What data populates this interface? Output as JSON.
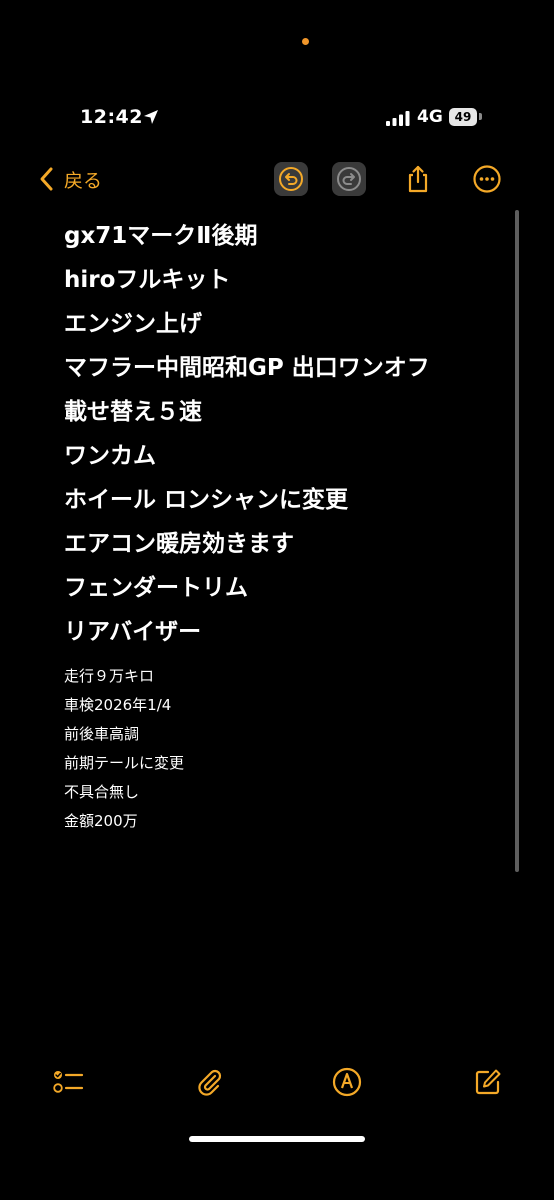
{
  "status_bar": {
    "time": "12:42",
    "network": "4G",
    "battery": "49"
  },
  "nav": {
    "back_label": "戻る"
  },
  "note": {
    "heading_lines": [
      "gx71マークⅡ後期",
      "hiroフルキット",
      "エンジン上げ",
      "マフラー中間昭和GP 出口ワンオフ",
      "載せ替え５速",
      "ワンカム",
      "ホイール ロンシャンに変更",
      "エアコン暖房効きます",
      "フェンダートリム",
      "リアバイザー"
    ],
    "body_lines": [
      "走行９万キロ",
      "車検2026年1/4",
      "前後車高調",
      "前期テールに変更",
      "不具合無し",
      "金額200万"
    ]
  },
  "colors": {
    "accent": "#f4a928",
    "background": "#000000",
    "text": "#ffffff"
  },
  "icons": {
    "back": "chevron-left-icon",
    "undo": "undo-icon",
    "redo": "redo-icon",
    "share": "share-icon",
    "more": "more-icon",
    "checklist": "checklist-icon",
    "attachment": "paperclip-icon",
    "markup": "markup-pen-icon",
    "compose": "compose-icon"
  }
}
